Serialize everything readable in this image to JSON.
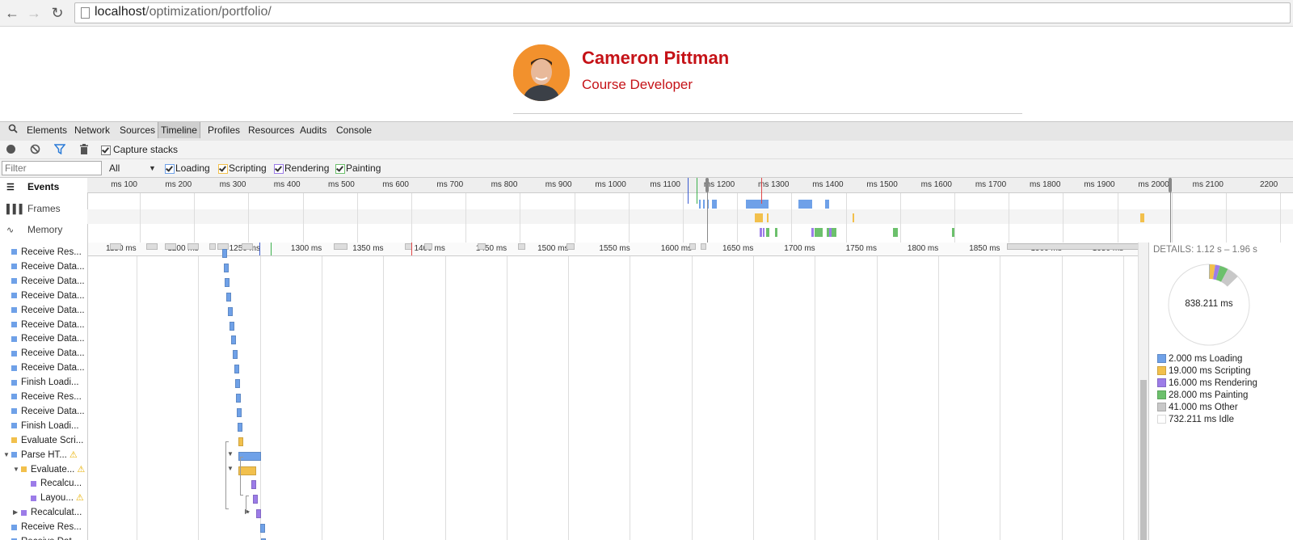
{
  "browser": {
    "url_host": "localhost",
    "url_path": "/optimization/portfolio/"
  },
  "profile": {
    "name": "Cameron Pittman",
    "role": "Course Developer"
  },
  "devtools": {
    "tabs": [
      "Elements",
      "Network",
      "Sources",
      "Timeline",
      "Profiles",
      "Resources",
      "Audits",
      "Console"
    ],
    "active_tab": "Timeline",
    "capture_stacks_label": "Capture stacks",
    "filter_placeholder": "Filter",
    "filter_select_value": "All",
    "categories": [
      {
        "label": "Loading",
        "color": "#6fa1e8"
      },
      {
        "label": "Scripting",
        "color": "#f2c04c"
      },
      {
        "label": "Rendering",
        "color": "#9c7ce8"
      },
      {
        "label": "Painting",
        "color": "#6cc06c"
      }
    ],
    "overview_modes": [
      "Events",
      "Frames",
      "Memory"
    ],
    "overview_ticks": [
      "100 ms",
      "200 ms",
      "300 ms",
      "400 ms",
      "500 ms",
      "600 ms",
      "700 ms",
      "800 ms",
      "900 ms",
      "1000 ms",
      "1100 ms",
      "1200 ms",
      "1300 ms",
      "1400 ms",
      "1500 ms",
      "1600 ms",
      "1700 ms",
      "1800 ms",
      "1900 ms",
      "2000 ms",
      "2100 ms",
      "2200"
    ],
    "detail_ticks": [
      "1150 ms",
      "1200 ms",
      "1250 ms",
      "1300 ms",
      "1350 ms",
      "1400 ms",
      "1450 ms",
      "1500 ms",
      "1550 ms",
      "1600 ms",
      "1650 ms",
      "1700 ms",
      "1750 ms",
      "1800 ms",
      "1850 ms",
      "1900 ms",
      "1950 ms"
    ],
    "records": [
      {
        "label": "Receive Res...",
        "color": "#6fa1e8",
        "indent": 0,
        "tri": "",
        "warn": false
      },
      {
        "label": "Receive Data...",
        "color": "#6fa1e8",
        "indent": 0,
        "tri": "",
        "warn": false
      },
      {
        "label": "Receive Data...",
        "color": "#6fa1e8",
        "indent": 0,
        "tri": "",
        "warn": false
      },
      {
        "label": "Receive Data...",
        "color": "#6fa1e8",
        "indent": 0,
        "tri": "",
        "warn": false
      },
      {
        "label": "Receive Data...",
        "color": "#6fa1e8",
        "indent": 0,
        "tri": "",
        "warn": false
      },
      {
        "label": "Receive Data...",
        "color": "#6fa1e8",
        "indent": 0,
        "tri": "",
        "warn": false
      },
      {
        "label": "Receive Data...",
        "color": "#6fa1e8",
        "indent": 0,
        "tri": "",
        "warn": false
      },
      {
        "label": "Receive Data...",
        "color": "#6fa1e8",
        "indent": 0,
        "tri": "",
        "warn": false
      },
      {
        "label": "Receive Data...",
        "color": "#6fa1e8",
        "indent": 0,
        "tri": "",
        "warn": false
      },
      {
        "label": "Finish Loadi...",
        "color": "#6fa1e8",
        "indent": 0,
        "tri": "",
        "warn": false
      },
      {
        "label": "Receive Res...",
        "color": "#6fa1e8",
        "indent": 0,
        "tri": "",
        "warn": false
      },
      {
        "label": "Receive Data...",
        "color": "#6fa1e8",
        "indent": 0,
        "tri": "",
        "warn": false
      },
      {
        "label": "Finish Loadi...",
        "color": "#6fa1e8",
        "indent": 0,
        "tri": "",
        "warn": false
      },
      {
        "label": "Evaluate Scri...",
        "color": "#f2c04c",
        "indent": 0,
        "tri": "",
        "warn": false
      },
      {
        "label": "Parse HT...",
        "color": "#6fa1e8",
        "indent": 0,
        "tri": "▼",
        "warn": true
      },
      {
        "label": "Evaluate...",
        "color": "#f2c04c",
        "indent": 1,
        "tri": "▼",
        "warn": true
      },
      {
        "label": "Recalcu...",
        "color": "#9c7ce8",
        "indent": 2,
        "tri": "",
        "warn": false
      },
      {
        "label": "Layou...",
        "color": "#9c7ce8",
        "indent": 2,
        "tri": "",
        "warn": true
      },
      {
        "label": "Recalculat...",
        "color": "#9c7ce8",
        "indent": 1,
        "tri": "▶",
        "warn": false
      },
      {
        "label": "Receive Res...",
        "color": "#6fa1e8",
        "indent": 0,
        "tri": "",
        "warn": false
      },
      {
        "label": "Receive Dat...",
        "color": "#6fa1e8",
        "indent": 0,
        "tri": "",
        "warn": false
      }
    ],
    "details": {
      "header": "DETAILS: 1.12 s – 1.96 s",
      "total": "838.211 ms",
      "legend": [
        {
          "label": "2.000 ms Loading",
          "color": "#6fa1e8",
          "ms": 2.0
        },
        {
          "label": "19.000 ms Scripting",
          "color": "#f2c04c",
          "ms": 19.0
        },
        {
          "label": "16.000 ms Rendering",
          "color": "#9c7ce8",
          "ms": 16.0
        },
        {
          "label": "28.000 ms Painting",
          "color": "#6cc06c",
          "ms": 28.0
        },
        {
          "label": "41.000 ms Other",
          "color": "#c8c8c8",
          "ms": 41.0
        },
        {
          "label": "732.211 ms Idle",
          "color": "#ffffff",
          "ms": 732.211
        }
      ]
    }
  }
}
